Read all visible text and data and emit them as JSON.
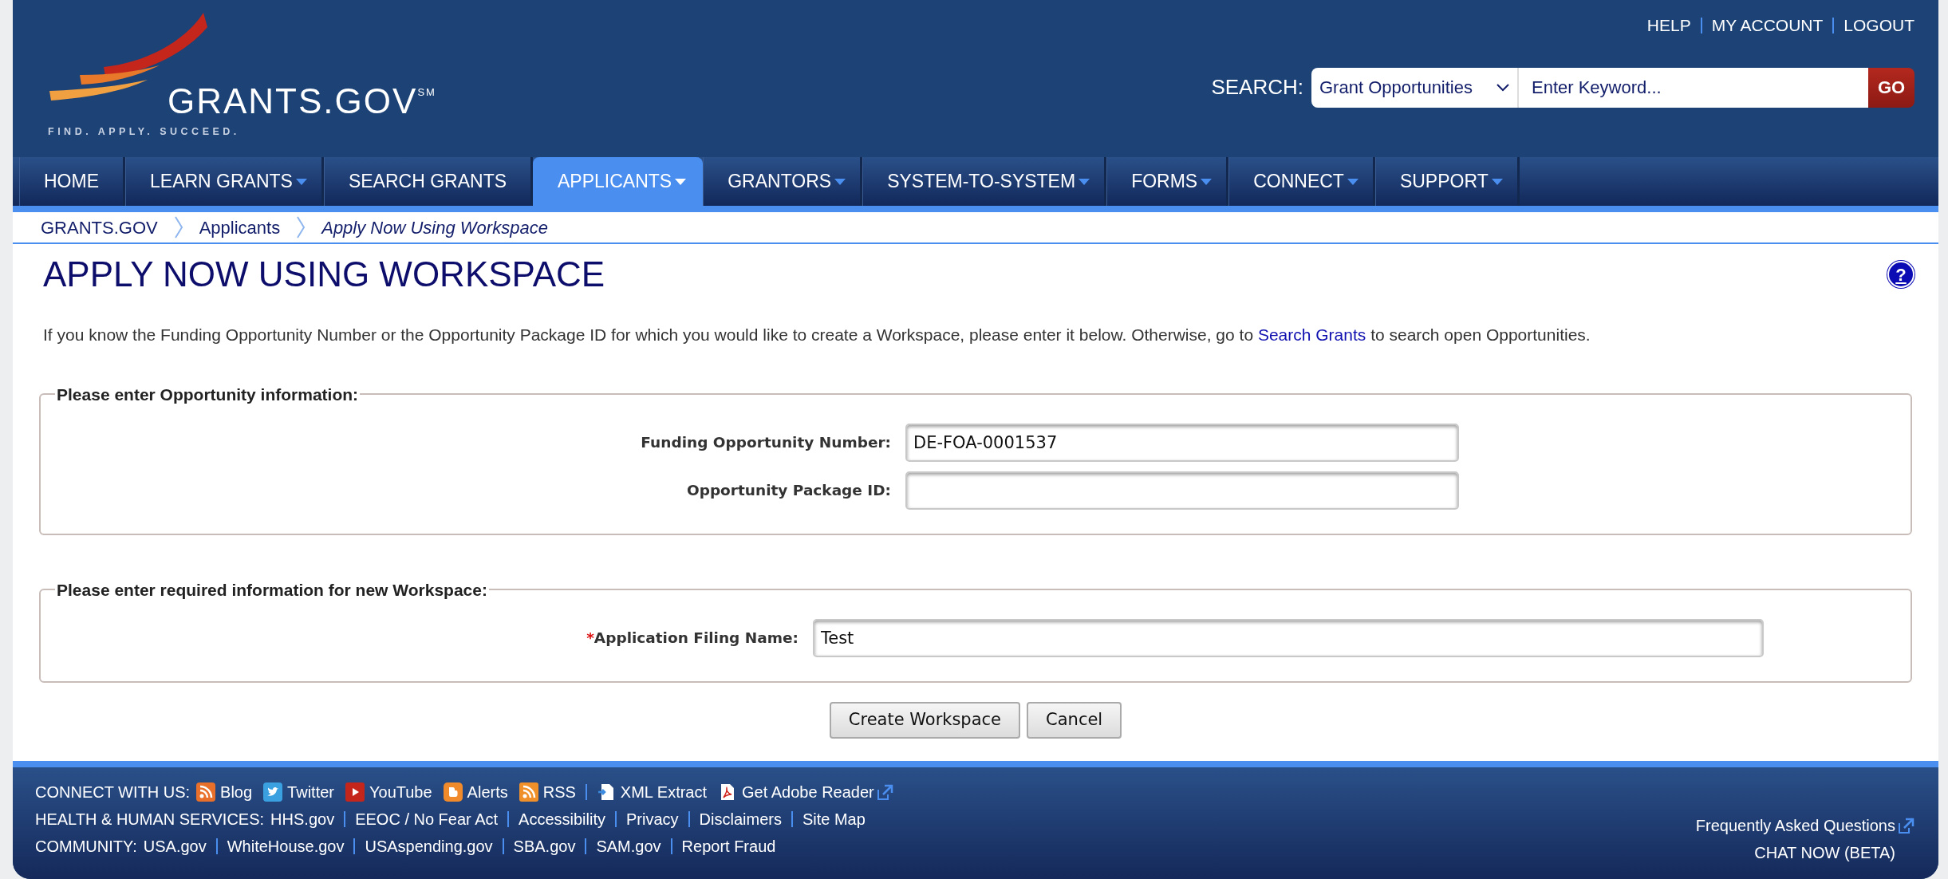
{
  "top_links": [
    "HELP",
    "MY ACCOUNT",
    "LOGOUT"
  ],
  "logo": {
    "name": "GRANTS.GOV",
    "mark": "SM",
    "tagline": "FIND. APPLY. SUCCEED."
  },
  "search": {
    "label": "SEARCH:",
    "category": "Grant Opportunities",
    "placeholder": "Enter Keyword...",
    "button": "GO"
  },
  "nav": [
    {
      "label": "HOME",
      "dropdown": false,
      "selected": false
    },
    {
      "label": "LEARN GRANTS",
      "dropdown": true,
      "selected": false
    },
    {
      "label": "SEARCH GRANTS",
      "dropdown": false,
      "selected": false
    },
    {
      "label": "APPLICANTS",
      "dropdown": true,
      "selected": true
    },
    {
      "label": "GRANTORS",
      "dropdown": true,
      "selected": false
    },
    {
      "label": "SYSTEM-TO-SYSTEM",
      "dropdown": true,
      "selected": false
    },
    {
      "label": "FORMS",
      "dropdown": true,
      "selected": false
    },
    {
      "label": "CONNECT",
      "dropdown": true,
      "selected": false
    },
    {
      "label": "SUPPORT",
      "dropdown": true,
      "selected": false
    }
  ],
  "breadcrumb": [
    {
      "label": "GRANTS.GOV",
      "current": false
    },
    {
      "label": "Applicants",
      "current": false
    },
    {
      "label": "Apply Now Using Workspace",
      "current": true
    }
  ],
  "page": {
    "title": "APPLY NOW USING WORKSPACE",
    "help": "?",
    "intro_before": "If you know the Funding Opportunity Number or the Opportunity Package ID for which you would like to create a Workspace, please enter it below. Otherwise, go to ",
    "intro_link": "Search Grants",
    "intro_after": " to search open Opportunities."
  },
  "fieldsets": [
    {
      "legend": "Please enter Opportunity information:",
      "fields": [
        {
          "label": "Funding Opportunity Number:",
          "value": "DE-FOA-0001537"
        },
        {
          "label": "Opportunity Package ID:"
        }
      ]
    },
    {
      "legend": "Please enter required information for new Workspace:",
      "fields": [
        {
          "marker": "*",
          "label": "Application Filing Name:",
          "value": "Test"
        }
      ]
    }
  ],
  "buttons": [
    "Create Workspace",
    "Cancel"
  ],
  "footer": {
    "rows": [
      {
        "label": "CONNECT WITH US:",
        "links": [
          {
            "text": "Blog",
            "kind": "blog",
            "separated": false
          },
          {
            "text": "Twitter",
            "kind": "twitter",
            "separated": false
          },
          {
            "text": "YouTube",
            "kind": "youtube",
            "separated": false
          },
          {
            "text": "Alerts",
            "kind": "alerts",
            "separated": false
          },
          {
            "text": "RSS",
            "kind": "rss",
            "separated": false
          },
          {
            "text": "XML Extract",
            "kind": "xml",
            "separated": true
          },
          {
            "text": "Get Adobe Reader",
            "kind": "pdf",
            "separated": false,
            "external": true
          }
        ]
      },
      {
        "label": "HEALTH & HUMAN SERVICES:",
        "links": [
          {
            "text": "HHS.gov",
            "separated": false
          },
          {
            "text": "EEOC / No Fear Act",
            "separated": true
          },
          {
            "text": "Accessibility",
            "separated": true
          },
          {
            "text": "Privacy",
            "separated": true
          },
          {
            "text": "Disclaimers",
            "separated": true
          },
          {
            "text": "Site Map",
            "separated": true
          }
        ]
      },
      {
        "label": "COMMUNITY:",
        "links": [
          {
            "text": "USA.gov",
            "separated": false
          },
          {
            "text": "WhiteHouse.gov",
            "separated": true
          },
          {
            "text": "USAspending.gov",
            "separated": true
          },
          {
            "text": "SBA.gov",
            "separated": true
          },
          {
            "text": "SAM.gov",
            "separated": true
          },
          {
            "text": "Report Fraud",
            "separated": true
          }
        ]
      }
    ],
    "right": [
      {
        "text": "Frequently Asked Questions",
        "external": true
      },
      {
        "text": "CHAT NOW (BETA)",
        "external": false
      }
    ]
  }
}
